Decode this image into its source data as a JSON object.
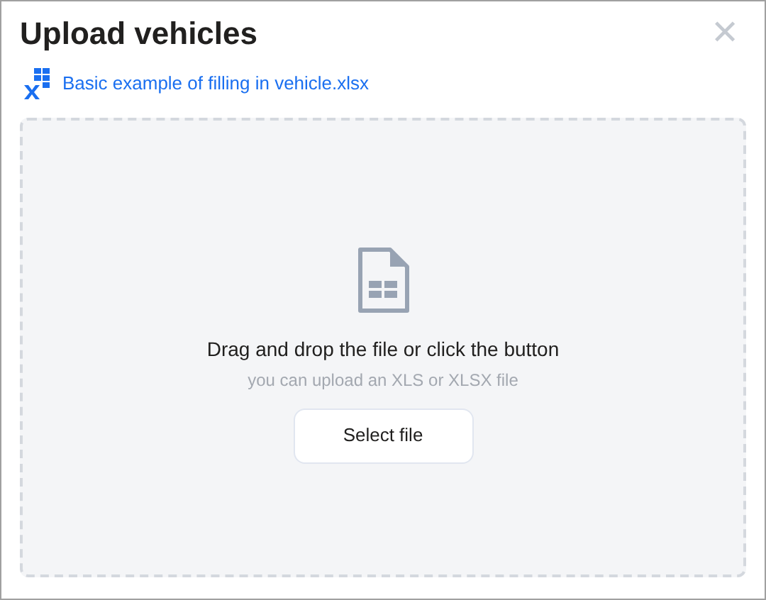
{
  "dialog": {
    "title": "Upload vehicles",
    "close": "✕"
  },
  "example_link": "Basic example of filling in vehicle.xlsx",
  "dropzone": {
    "heading": "Drag and drop the file or click the button",
    "hint": "you can upload an XLS or XLSX file",
    "button": "Select file"
  }
}
